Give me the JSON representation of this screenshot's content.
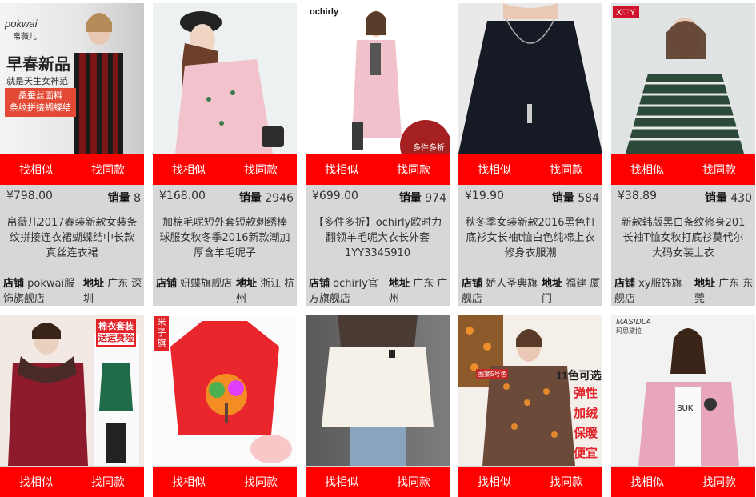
{
  "buttons": {
    "similar": "找相似",
    "same": "找同款"
  },
  "labels": {
    "sales": "销量",
    "shop": "店铺",
    "location": "地址"
  },
  "products_row1": [
    {
      "brand": "pokwai",
      "brand_cn": "帛薇儿",
      "ad_headline": "早春新品",
      "ad_sub": "就是天生女神范",
      "ad_tag1": "桑蚕丝面料",
      "ad_tag2": "条纹拼接蝴蝶结",
      "price": "¥798.00",
      "sales": "8",
      "title_lines": [
        "帛薇儿2017春装新款女装条",
        "纹拼接连衣裙蝴蝶结中长款",
        "真丝连衣裙"
      ],
      "shop": "pokwai服饰旗舰店",
      "location": "广东 深圳"
    },
    {
      "price": "¥168.00",
      "sales": "2946",
      "title_lines": [
        "加棉毛呢短外套短款刺绣棒",
        "球服女秋冬季2016新款潮加",
        "厚含羊毛呢子"
      ],
      "shop": "妍蝶旗舰店",
      "location": "浙江 杭州"
    },
    {
      "brand": "ochirly",
      "ad_badge": "多件多折",
      "price": "¥699.00",
      "sales": "974",
      "title_lines": [
        "【多件多折】ochirly欧时力",
        "翻领羊毛呢大衣长外套",
        "1YY3345910"
      ],
      "shop": "ochirly官方旗舰店",
      "location": "广东 广州"
    },
    {
      "price": "¥19.90",
      "sales": "584",
      "title_lines": [
        "秋冬季女装新款2016黑色打",
        "底衫女长袖t恤白色纯棉上衣",
        "修身衣服潮"
      ],
      "shop": "娇人圣典旗舰店",
      "location": "福建 厦门"
    },
    {
      "brand": "X♡Y",
      "price": "¥38.89",
      "sales": "430",
      "title_lines": [
        "新款韩版黑白条纹修身201",
        "长袖T恤女秋打底衫莫代尔",
        "大码女装上衣"
      ],
      "shop": "xy服饰旗舰店",
      "location": "广东 东莞"
    }
  ],
  "products_row2": [
    {
      "ad_banner1": "棉衣套装",
      "ad_banner2": "送运费险"
    },
    {
      "ad_tag": "米子旗"
    },
    {},
    {
      "ad_colors": "11色可选",
      "ad_words": [
        "弹性",
        "加绒",
        "保暖",
        "便宜"
      ],
      "ad_small": "图案5号色"
    },
    {
      "brand": "MASIDLA",
      "brand_sub": "玛思黛拉",
      "shirt_text": "SUK"
    }
  ],
  "colors": {
    "accent_red": "#ff0000",
    "card_bg": "#d7d7d7"
  }
}
